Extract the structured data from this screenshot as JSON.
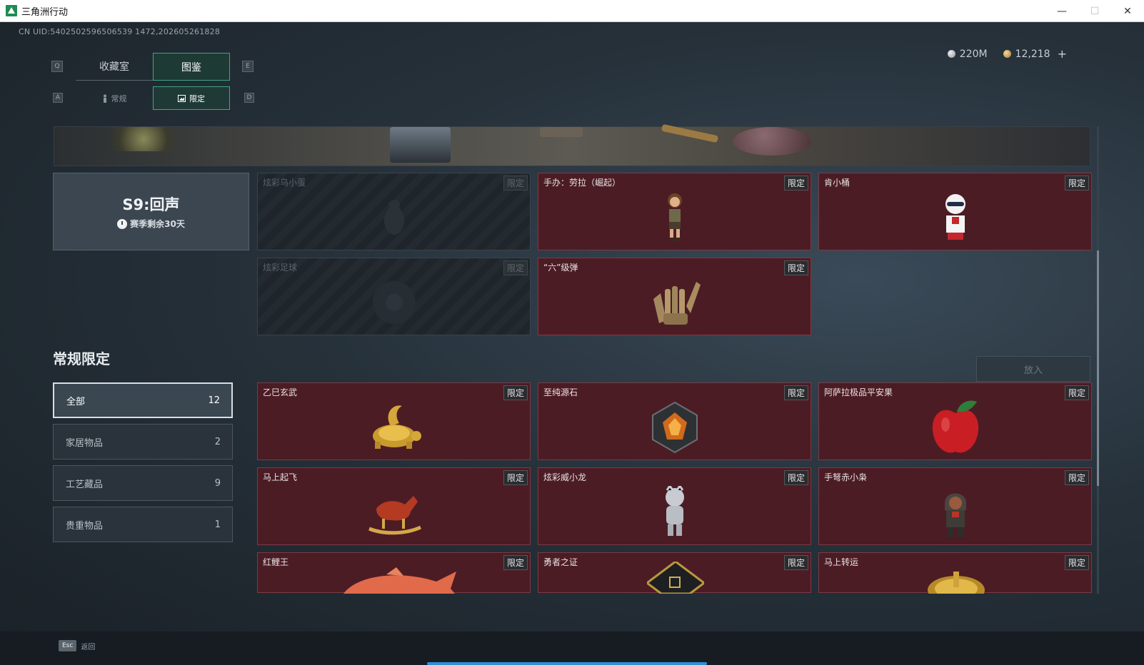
{
  "window": {
    "title": "三角洲行动",
    "minimize": "—",
    "maximize": "☐",
    "close": "✕"
  },
  "uid": "CN UID:5402502596506539 1472,202605261828",
  "currency": {
    "silver": "220M",
    "gold": "12,218",
    "plus": "+"
  },
  "tabs": {
    "prev_key": "Q",
    "next_key": "E",
    "items": [
      {
        "label": "收藏室",
        "active": false
      },
      {
        "label": "图鉴",
        "active": true
      }
    ]
  },
  "subtabs": {
    "prev_key": "A",
    "next_key": "D",
    "items": [
      {
        "label": "常规",
        "icon": "figure-icon",
        "active": false
      },
      {
        "label": "限定",
        "icon": "picture-icon",
        "active": true
      }
    ]
  },
  "season": {
    "title": "S9:回声",
    "remaining": "赛季剩余30天"
  },
  "season_items": [
    {
      "name": "炫彩乌小蛋",
      "tag": "限定",
      "locked": true
    },
    {
      "name": "手办：劳拉（崛起）",
      "tag": "限定",
      "locked": false
    },
    {
      "name": "肯小桶",
      "tag": "限定",
      "locked": false
    },
    {
      "name": "炫彩足球",
      "tag": "限定",
      "locked": true
    },
    {
      "name": "“六”级弹",
      "tag": "限定",
      "locked": false
    }
  ],
  "section": {
    "title": "常规限定",
    "place_button": "放入"
  },
  "categories": [
    {
      "label": "全部",
      "count": "12",
      "active": true
    },
    {
      "label": "家居物品",
      "count": "2",
      "active": false
    },
    {
      "label": "工艺藏品",
      "count": "9",
      "active": false
    },
    {
      "label": "贵重物品",
      "count": "1",
      "active": false
    }
  ],
  "items": [
    {
      "name": "乙巳玄武",
      "tag": "限定"
    },
    {
      "name": "至纯源石",
      "tag": "限定"
    },
    {
      "name": "阿萨拉极品平安果",
      "tag": "限定"
    },
    {
      "name": "马上起飞",
      "tag": "限定"
    },
    {
      "name": "炫彩威小龙",
      "tag": "限定"
    },
    {
      "name": "手弩赤小枭",
      "tag": "限定"
    },
    {
      "name": "红鲤王",
      "tag": "限定"
    },
    {
      "name": "勇者之证",
      "tag": "限定"
    },
    {
      "name": "马上转运",
      "tag": "限定"
    }
  ],
  "footer": {
    "esc_key": "Esc",
    "esc_label": "返回"
  },
  "colors": {
    "accent": "#3fa784",
    "card_bg": "#4c1c25",
    "progress": "#2e8fd6"
  }
}
